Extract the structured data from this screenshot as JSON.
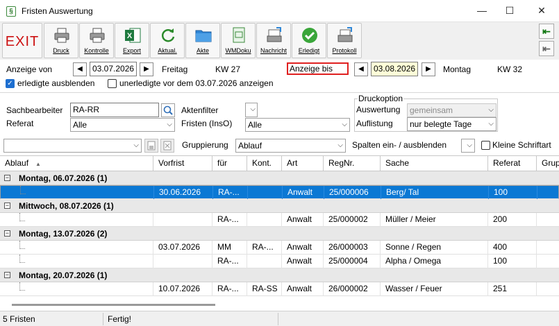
{
  "window": {
    "title": "Fristen Auswertung",
    "icon_glyph": "§",
    "minimize": "—",
    "maximize": "☐",
    "close": "✕"
  },
  "toolbar": {
    "exit": "EXIT",
    "buttons": [
      {
        "label": "Druck",
        "icon": "printer-icon"
      },
      {
        "label": "Kontrolle",
        "icon": "printer-icon"
      },
      {
        "label": "Export",
        "icon": "excel-icon"
      },
      {
        "label": "Aktual.",
        "icon": "refresh-icon"
      },
      {
        "label": "Akte",
        "icon": "folder-icon"
      },
      {
        "label": "WMDoku",
        "icon": "document-icon"
      },
      {
        "label": "Nachricht",
        "icon": "message-icon"
      },
      {
        "label": "Erledigt",
        "icon": "check-icon"
      },
      {
        "label": "Protokoll",
        "icon": "log-icon"
      }
    ]
  },
  "range": {
    "from_label": "Anzeige von",
    "from_date": "03.07.2026",
    "from_day": "Freitag",
    "from_week": "KW 27",
    "to_label": "Anzeige bis",
    "to_date": "03.08.2026",
    "to_day": "Montag",
    "to_week": "KW 32",
    "hide_done": "erledigte ausblenden",
    "hide_done_checked": true,
    "show_open_before": "unerledigte vor dem 03.07.2026 anzeigen",
    "show_open_before_checked": false
  },
  "filters": {
    "clerk_label": "Sachbearbeiter",
    "clerk_value": "RA-RR",
    "dept_label": "Referat",
    "dept_value": "Alle",
    "file_filter_label": "Aktenfilter",
    "deadline_label": "Fristen (InsO)",
    "deadline_value": "Alle",
    "print_group": "Druckoption",
    "eval_label": "Auswertung",
    "eval_value": "gemeinsam",
    "list_label": "Auflistung",
    "list_value": "nur belegte Tage"
  },
  "grouping": {
    "label": "Gruppierung",
    "value": "Ablauf",
    "columns_label": "Spalten ein- / ausblenden",
    "small_font": "Kleine Schriftart",
    "small_font_checked": false
  },
  "grid": {
    "columns": [
      "Ablauf",
      "Vorfrist",
      "für",
      "Kont.",
      "Art",
      "RegNr.",
      "Sache",
      "Referat",
      "Grup"
    ],
    "groups": [
      {
        "title": "Montag, 06.07.2026 (1)",
        "rows": [
          {
            "vorfrist": "30.06.2026",
            "fuer": "RA-...",
            "kont": "",
            "art": "Anwalt",
            "regnr": "25/000006",
            "sache": "Berg/ Tal",
            "referat": "100",
            "selected": true
          }
        ]
      },
      {
        "title": "Mittwoch, 08.07.2026 (1)",
        "rows": [
          {
            "vorfrist": "",
            "fuer": "RA-...",
            "kont": "",
            "art": "Anwalt",
            "regnr": "25/000002",
            "sache": "Müller / Meier",
            "referat": "200",
            "selected": false
          }
        ]
      },
      {
        "title": "Montag, 13.07.2026 (2)",
        "rows": [
          {
            "vorfrist": "03.07.2026",
            "fuer": "MM",
            "kont": "RA-...",
            "art": "Anwalt",
            "regnr": "26/000003",
            "sache": "Sonne / Regen",
            "referat": "400",
            "selected": false
          },
          {
            "vorfrist": "",
            "fuer": "RA-...",
            "kont": "",
            "art": "Anwalt",
            "regnr": "25/000004",
            "sache": "Alpha / Omega",
            "referat": "100",
            "selected": false
          }
        ]
      },
      {
        "title": "Montag, 20.07.2026 (1)",
        "rows": [
          {
            "vorfrist": "10.07.2026",
            "fuer": "RA-...",
            "kont": "RA-SS",
            "art": "Anwalt",
            "regnr": "26/000002",
            "sache": "Wasser / Feuer",
            "referat": "251",
            "selected": false
          }
        ]
      }
    ]
  },
  "status": {
    "count": "5 Fristen",
    "state": "Fertig!"
  }
}
